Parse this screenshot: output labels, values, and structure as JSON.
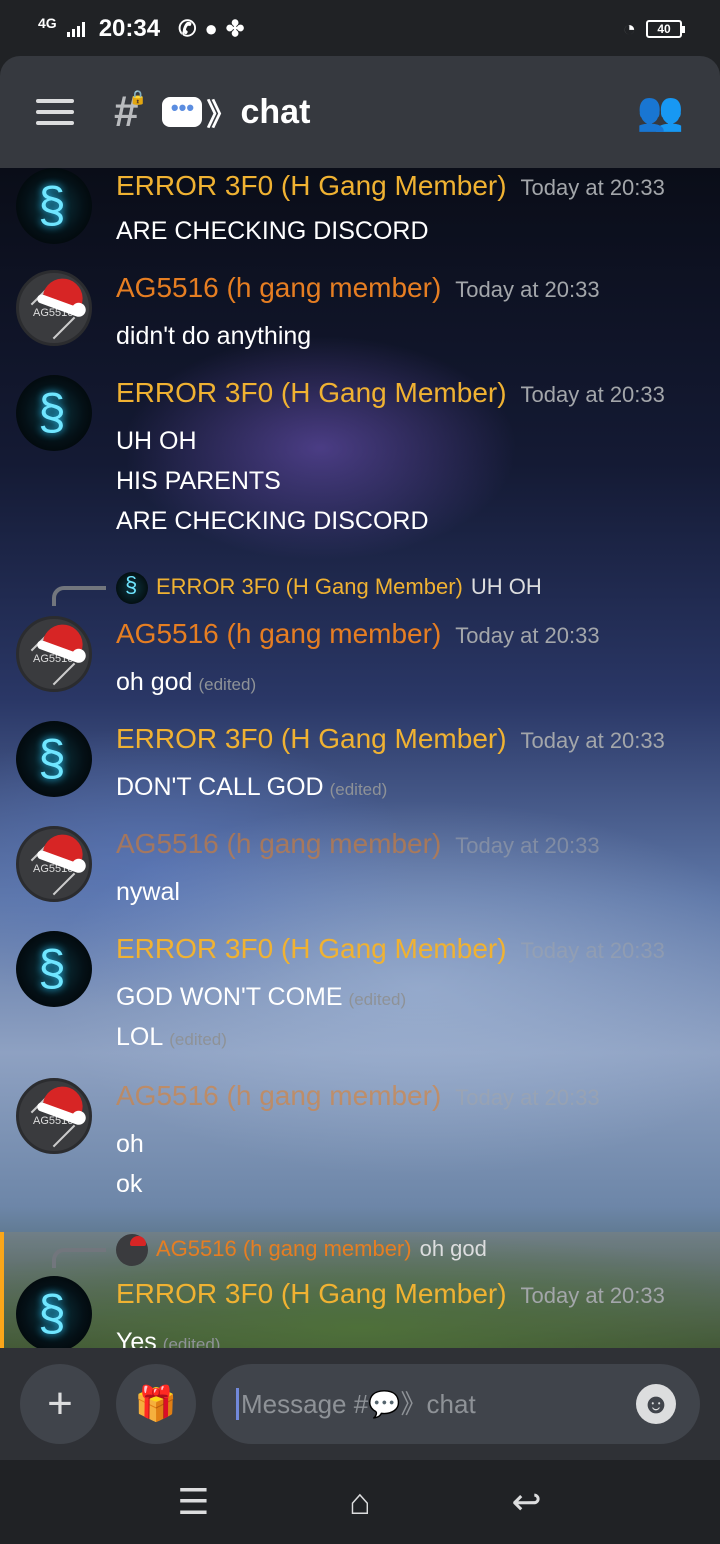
{
  "status_bar": {
    "network": "4G",
    "time": "20:34",
    "battery": "40",
    "notification_icons": [
      "whatsapp-icon",
      "message-icon",
      "fan-icon"
    ]
  },
  "header": {
    "channel_name": "chat",
    "channel_prefix_icon": "chat-bubble-icon"
  },
  "messages": [
    {
      "author": "ERROR 3F0 (H Gang Member)",
      "author_role": "error",
      "time": "Today at 20:33",
      "lines": [
        {
          "text": "ARE CHECKING DISCORD",
          "edited": ""
        }
      ]
    },
    {
      "author": "AG5516 (h gang member)",
      "author_role": "ag",
      "avatar_text": "AG5516",
      "time": "Today at 20:33",
      "lines": [
        {
          "text": "didn't do anything",
          "edited": ""
        }
      ]
    },
    {
      "author": "ERROR 3F0 (H Gang Member)",
      "author_role": "error",
      "time": "Today at 20:33",
      "lines": [
        {
          "text": "UH OH",
          "edited": ""
        },
        {
          "text": "HIS PARENTS",
          "edited": ""
        },
        {
          "text": "ARE CHECKING DISCORD",
          "edited": ""
        }
      ]
    },
    {
      "reply": {
        "author": "ERROR 3F0 (H Gang Member)",
        "text": "UH OH"
      },
      "author": "AG5516 (h gang member)",
      "author_role": "ag",
      "avatar_text": "AG5516",
      "time": "Today at 20:33",
      "lines": [
        {
          "text": "oh god",
          "edited": "(edited)"
        }
      ]
    },
    {
      "author": "ERROR 3F0 (H Gang Member)",
      "author_role": "error",
      "time": "Today at 20:33",
      "lines": [
        {
          "text": "DON'T CALL GOD",
          "edited": "(edited)"
        }
      ]
    },
    {
      "author": "AG5516 (h gang member)",
      "author_role": "ag",
      "avatar_text": "AG5516",
      "time": "Today at 20:33",
      "lines": [
        {
          "text": "nywal",
          "edited": ""
        }
      ]
    },
    {
      "author": "ERROR 3F0 (H Gang Member)",
      "author_role": "error",
      "time": "Today at 20:33",
      "lines": [
        {
          "text": "GOD WON'T COME",
          "edited": "(edited)"
        },
        {
          "text": "LOL",
          "edited": "(edited)"
        }
      ]
    },
    {
      "author": "AG5516 (h gang member)",
      "author_role": "ag",
      "avatar_text": "AG5516",
      "time": "Today at 20:33",
      "lines": [
        {
          "text": "oh",
          "edited": ""
        },
        {
          "text": "ok",
          "edited": ""
        }
      ]
    },
    {
      "reply": {
        "author": "AG5516 (h gang member)",
        "text": "oh god"
      },
      "author": "ERROR 3F0 (H Gang Member)",
      "author_role": "error",
      "time": "Today at 20:33",
      "lines": [
        {
          "text": "Yes",
          "edited": "(edited)"
        }
      ]
    }
  ],
  "composer": {
    "placeholder": "Message #💬》chat"
  }
}
